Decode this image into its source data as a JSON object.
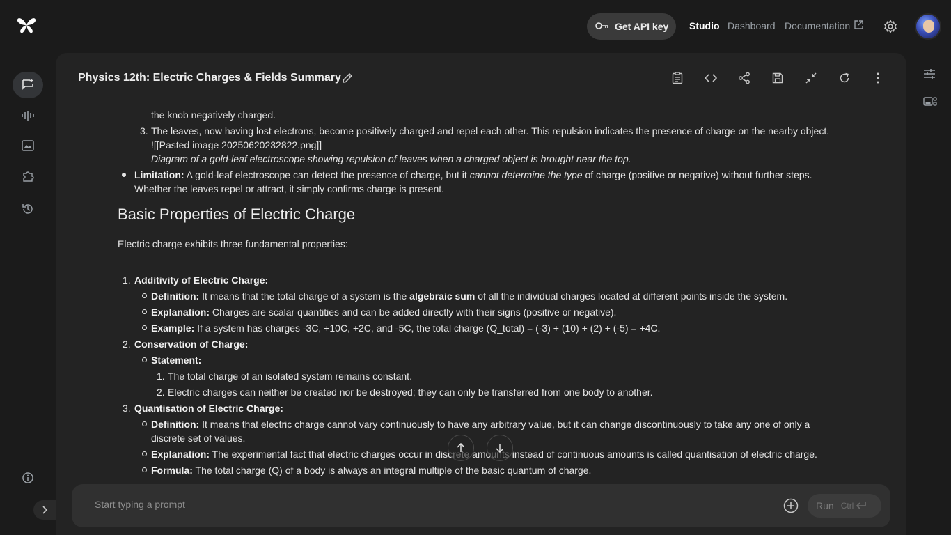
{
  "topbar": {
    "api_key_label": "Get API key",
    "nav_studio": "Studio",
    "nav_dashboard": "Dashboard",
    "nav_documentation": "Documentation"
  },
  "header": {
    "title": "Physics 12th: Electric Charges & Fields Summary"
  },
  "content": {
    "l1": "the knob negatively charged.",
    "l2_num": "3.",
    "l2": "The leaves, now having lost electrons, become positively charged and repel each other. This repulsion indicates the presence of charge on the nearby object.",
    "l3": "![[Pasted image 20250620232822.png]]",
    "l4": "Diagram of a gold-leaf electroscope showing repulsion of leaves when a charged object is brought near the top.",
    "lim_label": "Limitation:",
    "lim_a": " A gold-leaf electroscope can detect the presence of charge, but it ",
    "lim_i": "cannot determine the type",
    "lim_b": " of charge (positive or negative) without further steps.",
    "lim_2": "Whether the leaves repel or attract, it simply confirms charge is present.",
    "heading": "Basic Properties of Electric Charge",
    "intro": "Electric charge exhibits three fundamental properties:",
    "p1_num": "1.",
    "p1_title": "Additivity of Electric Charge:",
    "p1_def_label": "Definition:",
    "p1_def_a": " It means that the total charge of a system is the ",
    "p1_def_b": "algebraic sum",
    "p1_def_c": " of all the individual charges located at different points inside the system.",
    "p1_exp_label": "Explanation:",
    "p1_exp": " Charges are scalar quantities and can be added directly with their signs (positive or negative).",
    "p1_ex_label": "Example:",
    "p1_ex": " If a system has charges -3C, +10C, +2C, and -5C, the total charge (Q_total) = (-3) + (10) + (2) + (-5) = +4C.",
    "p2_num": "2.",
    "p2_title": "Conservation of Charge:",
    "p2_stmt_label": "Statement:",
    "p2_s1_num": "1.",
    "p2_s1": "The total charge of an isolated system remains constant.",
    "p2_s2_num": "2.",
    "p2_s2": "Electric charges can neither be created nor be destroyed; they can only be transferred from one body to another.",
    "p3_num": "3.",
    "p3_title": "Quantisation of Electric Charge:",
    "p3_def_label": "Definition:",
    "p3_def": " It means that electric charge cannot vary continuously to have any arbitrary value, but it can change discontinuously to take any one of only a",
    "p3_def2": "discrete set of values.",
    "p3_exp_label": "Explanation:",
    "p3_exp": " The experimental fact that electric charges occur in discrete amounts instead of continuous amounts is called quantisation of electric charge.",
    "p3_form_label": "Formula:",
    "p3_form": " The total charge (Q) of a body is always an integral multiple of the basic quantum of charge."
  },
  "prompt": {
    "placeholder": "Start typing a prompt",
    "run_label": "Run",
    "run_shortcut": "Ctrl"
  },
  "icons": {
    "logo": "gemini-spark-icon",
    "key": "key-icon",
    "external": "external-link-icon",
    "settings": "gear-icon"
  }
}
